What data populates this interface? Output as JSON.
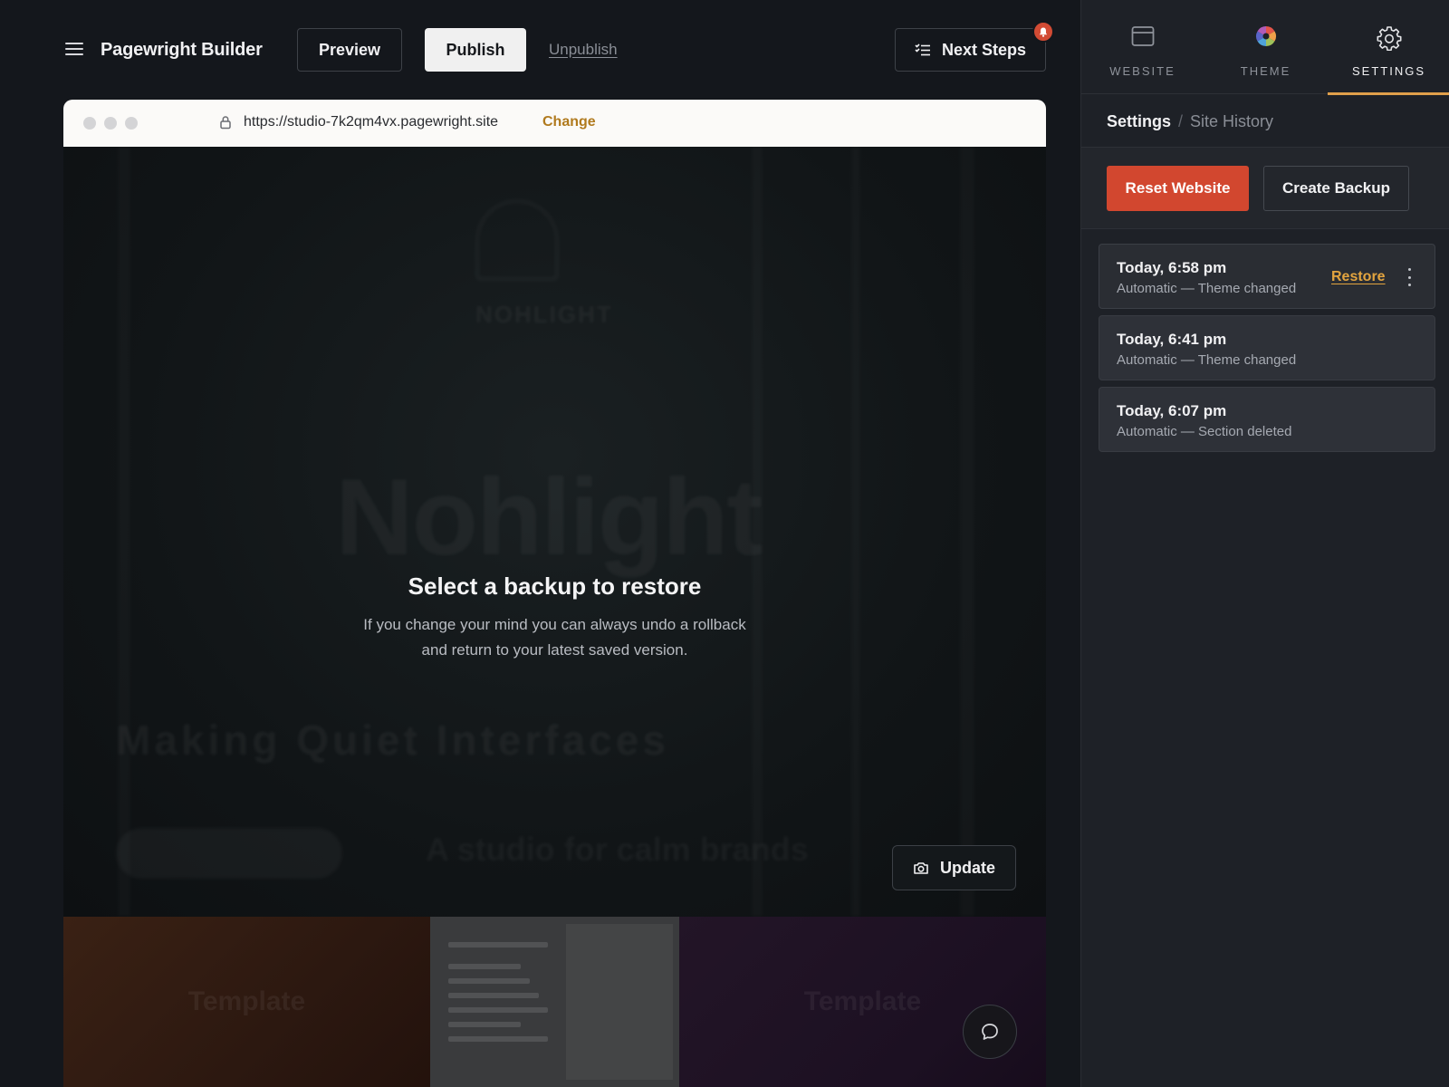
{
  "header": {
    "app_title": "Pagewright Builder",
    "preview_label": "Preview",
    "publish_label": "Publish",
    "unpublish_label": "Unpublish",
    "next_steps_label": "Next Steps"
  },
  "browser": {
    "url": "https://studio-7k2qm4vx.pagewright.site",
    "change_label": "Change"
  },
  "preview": {
    "title": "Select a backup to restore",
    "body": "If you change your mind you can always undo a rollback and return to your latest saved version.",
    "update_label": "Update",
    "ghost": {
      "brand": "NOHLIGHT",
      "big": "Nohlight",
      "headline": "Making Quiet Interfaces",
      "tagline": "A studio for calm brands"
    },
    "templates": [
      {
        "label": "Template"
      },
      {
        "label": ""
      },
      {
        "label": "Template"
      }
    ]
  },
  "panel": {
    "tabs": [
      {
        "label": "WEBSITE",
        "icon": "browser-window-icon"
      },
      {
        "label": "THEME",
        "icon": "color-wheel-icon"
      },
      {
        "label": "SETTINGS",
        "icon": "gear-icon"
      }
    ],
    "active_tab": "SETTINGS",
    "breadcrumb": {
      "root": "Settings",
      "separator": "/",
      "current": "Site History"
    },
    "reset_label": "Reset Website",
    "backup_label": "Create Backup",
    "backups": [
      {
        "time": "Today, 6:58 pm",
        "desc": "Automatic — Theme changed",
        "restore_label": "Restore"
      },
      {
        "time": "Today, 6:41 pm",
        "desc": "Automatic — Theme changed"
      },
      {
        "time": "Today, 6:07 pm",
        "desc": "Automatic — Section deleted"
      }
    ]
  },
  "colors": {
    "accent": "#e0a04b",
    "danger": "#d2472f",
    "panel_bg": "#1e2127",
    "app_bg": "#14171c"
  }
}
